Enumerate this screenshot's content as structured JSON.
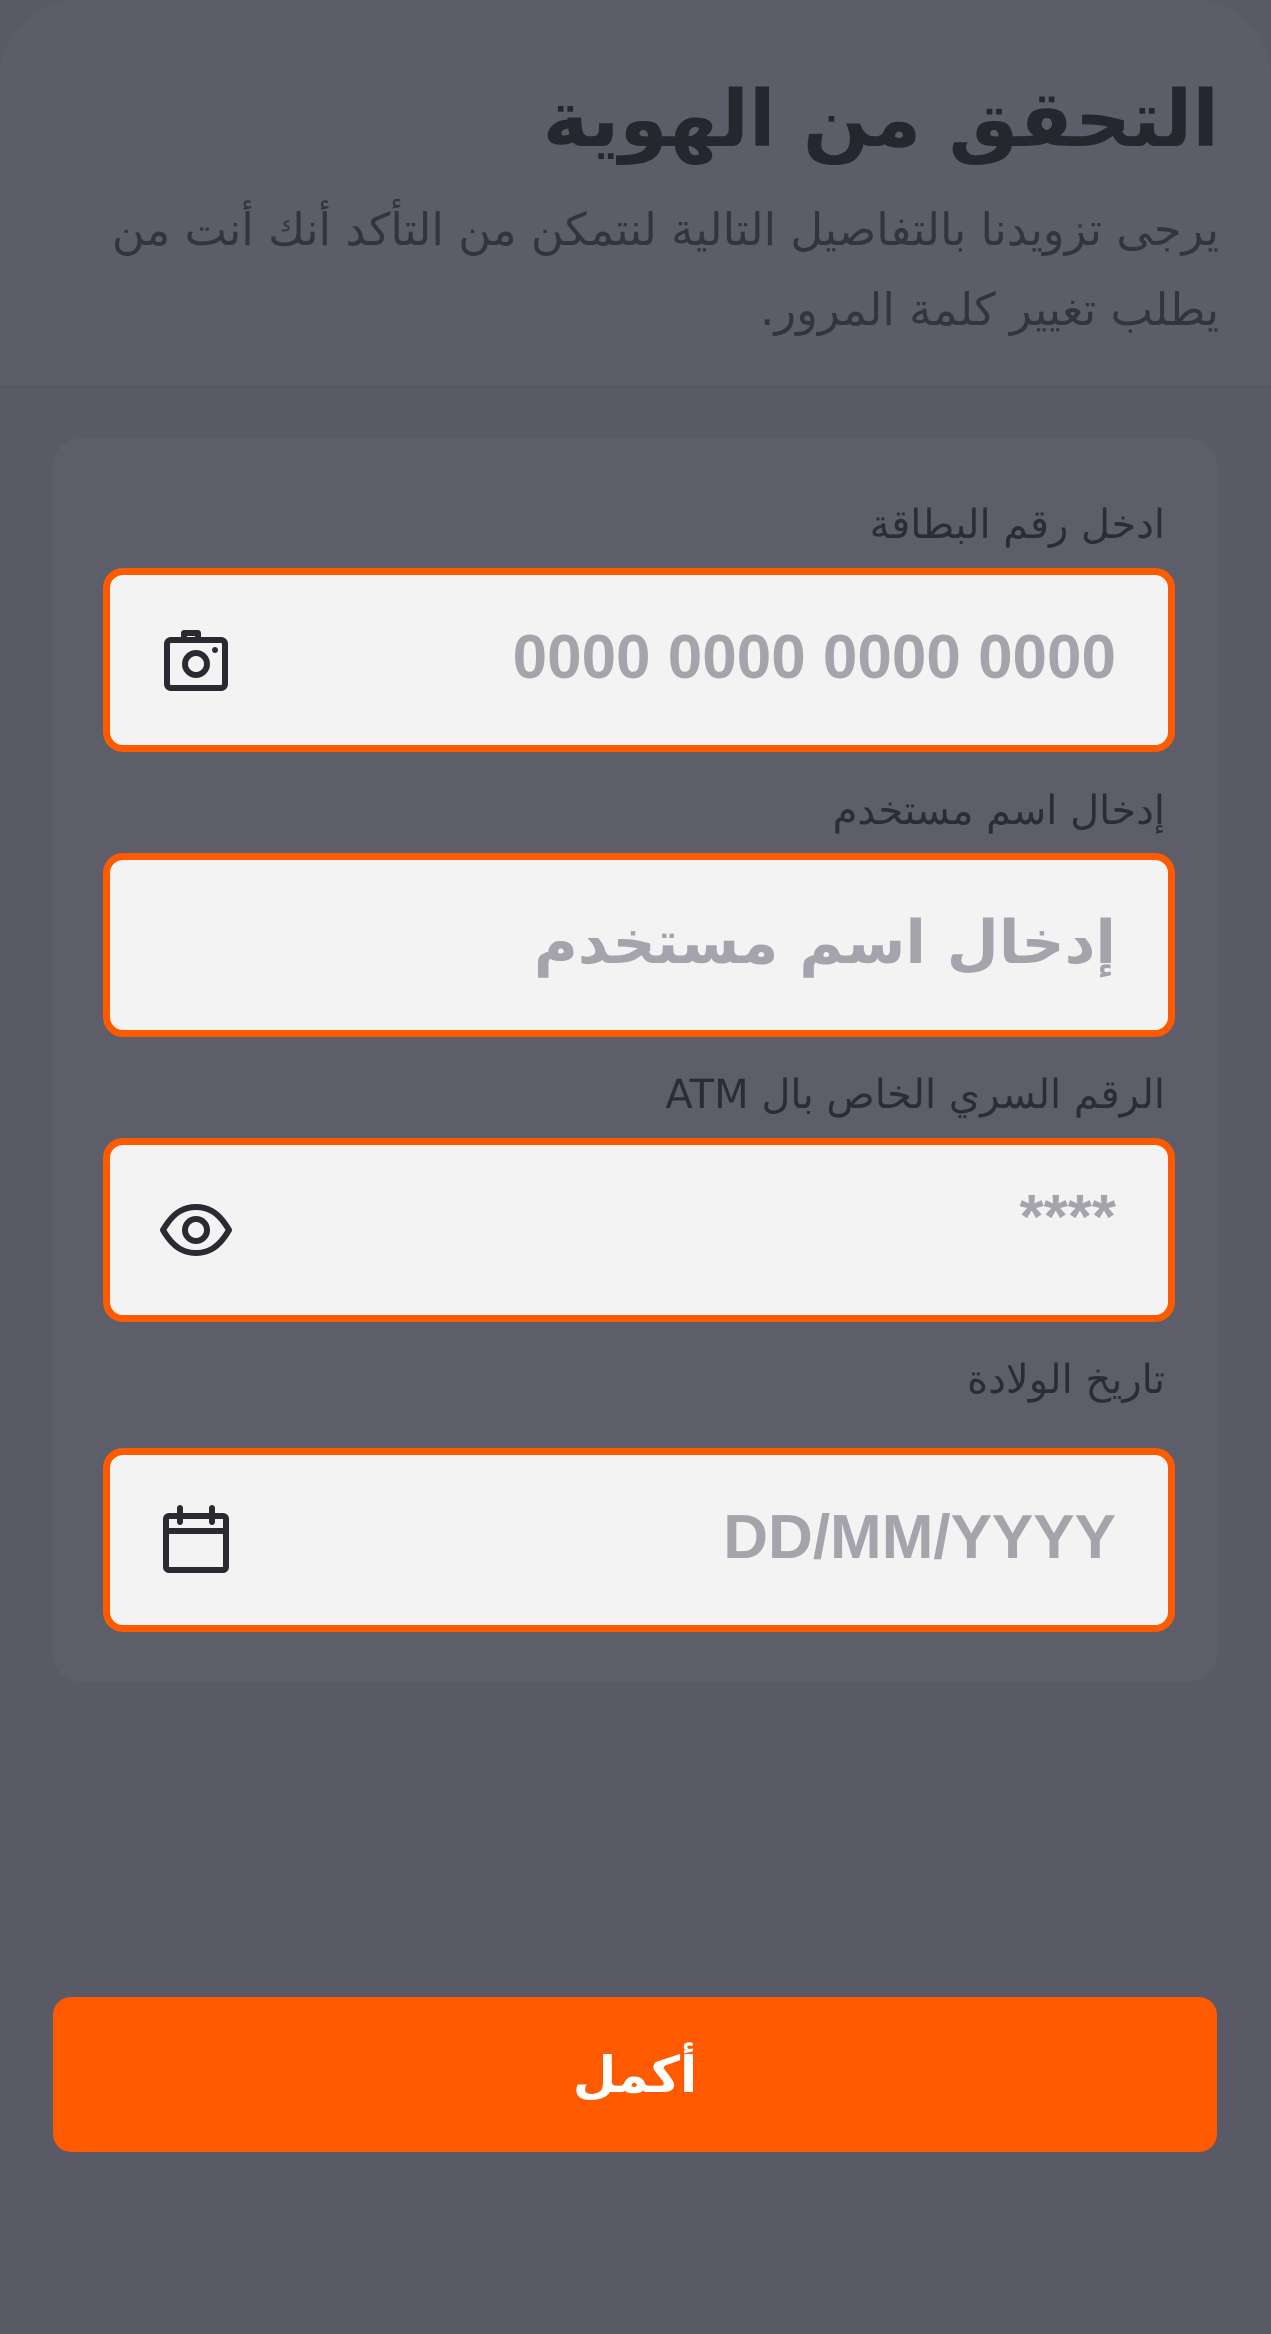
{
  "header": {
    "title": "التحقق من الهوية",
    "subtitle": "يرجى تزويدنا بالتفاصيل التالية لنتمكن من التأكد أنك أنت من يطلب تغيير كلمة المرور."
  },
  "form": {
    "card_number": {
      "label": "ادخل رقم البطاقة",
      "placeholder": "0000 0000 0000 0000",
      "icon": "camera-icon"
    },
    "username": {
      "label": "إدخال اسم مستخدم",
      "placeholder": "إدخال اسم مستخدم"
    },
    "atm_pin": {
      "label": "الرقم السري الخاص بال ATM",
      "placeholder": "****",
      "icon": "eye-icon"
    },
    "birth_date": {
      "label": "تاريخ الولادة",
      "placeholder": "DD/MM/YYYY",
      "icon": "calendar-icon"
    }
  },
  "submit": {
    "label": "أكمل"
  },
  "colors": {
    "accent": "#ff5a00",
    "overlay": "#5a5a66",
    "field_bg": "#f3f3f3",
    "placeholder": "#a4a4ad",
    "text_dark": "#26262e"
  }
}
